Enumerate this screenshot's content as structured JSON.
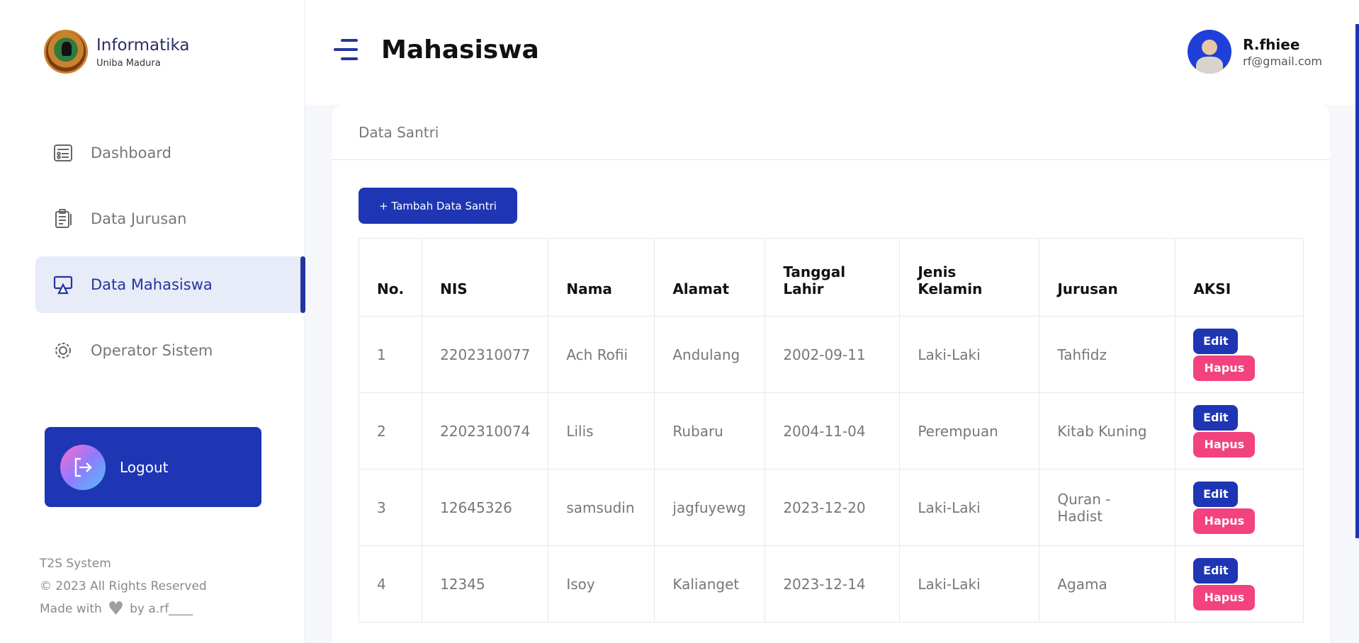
{
  "brand": {
    "title": "Informatika",
    "subtitle": "Uniba Madura"
  },
  "sidebar": {
    "items": [
      {
        "label": "Dashboard",
        "icon": "dashboard-icon",
        "active": false
      },
      {
        "label": "Data Jurusan",
        "icon": "clipboard-icon",
        "active": false
      },
      {
        "label": "Data Mahasiswa",
        "icon": "monitor-icon",
        "active": true
      },
      {
        "label": "Operator Sistem",
        "icon": "gear-icon",
        "active": false
      }
    ],
    "logout_label": "Logout",
    "footer": {
      "line1": "T2S System",
      "line2": "© 2023 All Rights Reserved",
      "made_with": "Made with",
      "by": "by a.rf____"
    }
  },
  "header": {
    "title": "Mahasiswa",
    "user_name": "R.fhiee",
    "user_email": "rf@gmail.com"
  },
  "card": {
    "title": "Data Santri",
    "add_button": "+ Tambah Data Santri",
    "columns": [
      "No.",
      "NIS",
      "Nama",
      "Alamat",
      "Tanggal Lahir",
      "Jenis Kelamin",
      "Jurusan",
      "AKSI"
    ],
    "rows": [
      {
        "no": "1",
        "nis": "2202310077",
        "nama": "Ach Rofii",
        "alamat": "Andulang",
        "tanggal": "2002-09-11",
        "jk": "Laki-Laki",
        "jurusan": "Tahfidz"
      },
      {
        "no": "2",
        "nis": "2202310074",
        "nama": "Lilis",
        "alamat": "Rubaru",
        "tanggal": "2004-11-04",
        "jk": "Perempuan",
        "jurusan": "Kitab Kuning"
      },
      {
        "no": "3",
        "nis": "12645326",
        "nama": "samsudin",
        "alamat": "jagfuyewg",
        "tanggal": "2023-12-20",
        "jk": "Laki-Laki",
        "jurusan": "Quran - Hadist"
      },
      {
        "no": "4",
        "nis": "12345",
        "nama": "Isoy",
        "alamat": "Kalianget",
        "tanggal": "2023-12-14",
        "jk": "Laki-Laki",
        "jurusan": "Agama"
      }
    ],
    "edit_label": "Edit",
    "hapus_label": "Hapus"
  },
  "colors": {
    "primary": "#1e36b3",
    "danger": "#f2427f",
    "active_bg": "#e8ebf8"
  }
}
